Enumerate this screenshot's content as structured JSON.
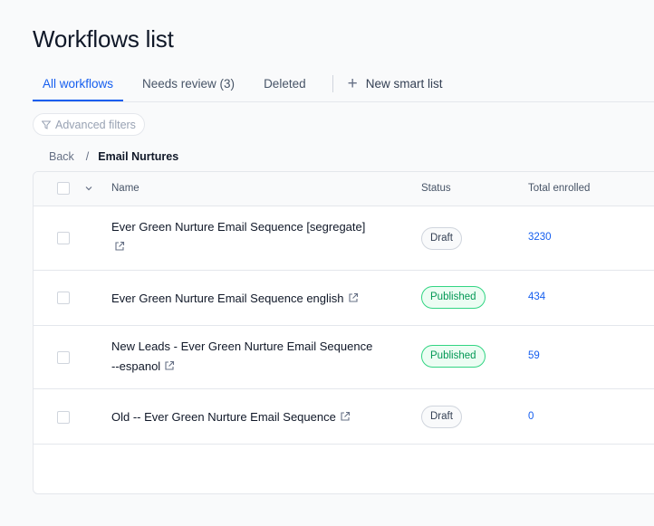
{
  "page": {
    "title": "Workflows list"
  },
  "tabs": [
    {
      "label": "All workflows",
      "active": true
    },
    {
      "label": "Needs review (3)",
      "active": false
    },
    {
      "label": "Deleted",
      "active": false
    }
  ],
  "new_smart_list": {
    "label": "New smart list"
  },
  "filters": {
    "label": "Advanced filters"
  },
  "breadcrumb": {
    "back": "Back",
    "separator": "/",
    "current": "Email Nurtures"
  },
  "table": {
    "columns": {
      "name": "Name",
      "status": "Status",
      "total_enrolled": "Total enrolled"
    },
    "rows": [
      {
        "name_lines": [
          "Ever Green Nurture Email Sequence [segregate]",
          ""
        ],
        "status": "Draft",
        "total_enrolled": "3230"
      },
      {
        "name_lines": [
          "Ever Green Nurture Email Sequence english"
        ],
        "status": "Published",
        "total_enrolled": "434"
      },
      {
        "name_lines": [
          "New Leads - Ever Green Nurture Email Sequence",
          "--espanol"
        ],
        "status": "Published",
        "total_enrolled": "59"
      },
      {
        "name_lines": [
          "Old -- Ever Green Nurture Email Sequence"
        ],
        "status": "Draft",
        "total_enrolled": "0"
      }
    ]
  },
  "colors": {
    "accent": "#155eef",
    "published_text": "#039855",
    "published_border": "#32d583",
    "published_bg": "#ecfdf3"
  }
}
